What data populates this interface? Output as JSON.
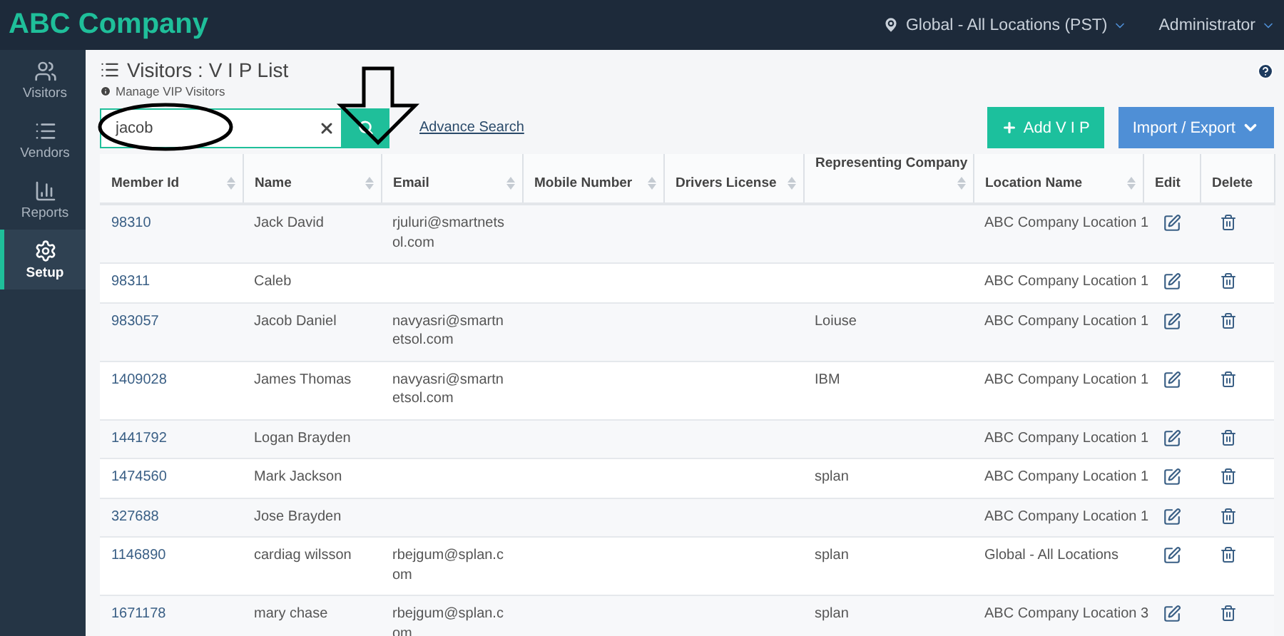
{
  "topbar": {
    "brand": "ABC Company",
    "location": "Global - All Locations (PST)",
    "user": "Administrator"
  },
  "sidebar": {
    "items": [
      {
        "label": "Visitors",
        "selected": false
      },
      {
        "label": "Vendors",
        "selected": false
      },
      {
        "label": "Reports",
        "selected": false
      },
      {
        "label": "Setup",
        "selected": true
      }
    ]
  },
  "page": {
    "title": "Visitors : V I P List",
    "subtitle": "Manage VIP Visitors"
  },
  "search": {
    "value": "jacob",
    "circled": true,
    "arrow_pointed": true,
    "advance_link": "Advance Search"
  },
  "actions": [
    {
      "label": "Add V I P",
      "kind": "add"
    },
    {
      "label": "Import / Export",
      "kind": "menu"
    }
  ],
  "table": {
    "columns": [
      {
        "label": "Member Id",
        "sortable": true
      },
      {
        "label": "Name",
        "sortable": true
      },
      {
        "label": "Email",
        "sortable": true
      },
      {
        "label": "Mobile Number",
        "sortable": true
      },
      {
        "label": "Drivers License",
        "sortable": true
      },
      {
        "label": "Representing Company",
        "sortable": true
      },
      {
        "label": "Location Name",
        "sortable": true
      },
      {
        "label": "Edit",
        "sortable": false
      },
      {
        "label": "Delete",
        "sortable": false
      }
    ],
    "rows": [
      {
        "member_id": "98310",
        "name": "Jack David",
        "email": "rjuluri@smartnetsol.com",
        "company": "",
        "location": "ABC Company Location 1"
      },
      {
        "member_id": "98311",
        "name": "Caleb",
        "email": "",
        "company": "",
        "location": "ABC Company Location 1"
      },
      {
        "member_id": "983057",
        "name": "Jacob Daniel",
        "email": "navyasri@smartnetsol.com",
        "company": "Loiuse",
        "location": "ABC Company Location 1"
      },
      {
        "member_id": "1409028",
        "name": "James Thomas",
        "email": "navyasri@smartnetsol.com",
        "company": "IBM",
        "location": "ABC Company Location 1"
      },
      {
        "member_id": "1441792",
        "name": "Logan Brayden",
        "email": "",
        "company": "",
        "location": "ABC Company Location 1"
      },
      {
        "member_id": "1474560",
        "name": "Mark Jackson",
        "email": "",
        "company": "splan",
        "location": "ABC Company Location 1"
      },
      {
        "member_id": "327688",
        "name": "Jose Brayden",
        "email": "",
        "company": "",
        "location": "ABC Company Location 1"
      },
      {
        "member_id": "1146890",
        "name": "cardiag wilsson",
        "email": "rbejgum@splan.com",
        "company": "splan",
        "location": "Global - All Locations"
      },
      {
        "member_id": "1671178",
        "name": "mary chase",
        "email": "rbejgum@splan.com",
        "company": "splan",
        "location": "ABC Company Location 3"
      }
    ]
  }
}
